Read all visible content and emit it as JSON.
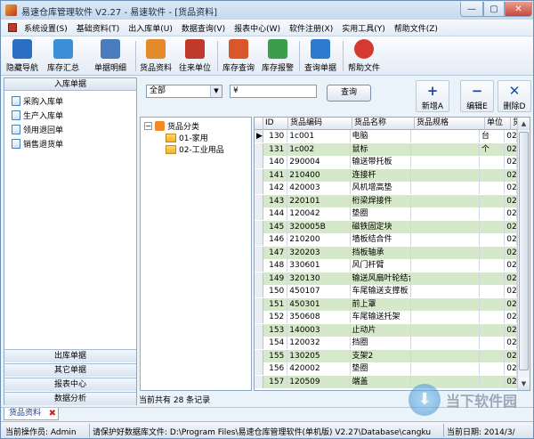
{
  "window": {
    "title": "易速仓库管理软件 V2.27 - 易速软件 - [货品资料]",
    "controls": {
      "minimize": "—",
      "maximize": "▢",
      "close": "✕"
    }
  },
  "menu": [
    "系统设置(S)",
    "基础资料(T)",
    "出入库单(U)",
    "数据查询(V)",
    "报表中心(W)",
    "软件注册(X)",
    "实用工具(Y)",
    "帮助文件(Z)"
  ],
  "toolbar": [
    {
      "label": "隐藏导航",
      "icon": "monitor-icon",
      "color": "#2a6fc4"
    },
    {
      "label": "库存汇总",
      "icon": "chart-icon",
      "color": "#3a8fd8"
    },
    {
      "label": "单据明细",
      "icon": "document-icon",
      "color": "#4a7bbf"
    },
    {
      "label": "货品资料",
      "icon": "box-icon",
      "color": "#e48a2b"
    },
    {
      "label": "往来单位",
      "icon": "people-icon",
      "color": "#c0392b"
    },
    {
      "label": "库存查询",
      "icon": "bar-chart-icon",
      "color": "#d9572a"
    },
    {
      "label": "库存报警",
      "icon": "alarm-icon",
      "color": "#3c9d4a"
    },
    {
      "label": "查询单据",
      "icon": "search-doc-icon",
      "color": "#2c7bd0"
    },
    {
      "label": "帮助文件",
      "icon": "help-icon",
      "color": "#d43a2f"
    }
  ],
  "sidebar": {
    "header": "入库单据",
    "items": [
      "采购入库单",
      "生产入库单",
      "领用退回单",
      "销售退货单"
    ],
    "sections": [
      "出库单据",
      "其它单据",
      "报表中心",
      "数据分析"
    ]
  },
  "filter": {
    "select_value": "全部",
    "search_value": "¥",
    "query_label": "查询"
  },
  "actions": [
    {
      "label": "新增A",
      "icon": "plus-icon",
      "glyph": "+"
    },
    {
      "label": "编辑E",
      "icon": "minus-icon",
      "glyph": "−"
    },
    {
      "label": "删除D",
      "icon": "delete-icon",
      "glyph": "✕"
    }
  ],
  "tree": {
    "root": "货品分类",
    "children": [
      "01-家用",
      "02-工业用品"
    ]
  },
  "grid": {
    "columns": [
      "ID",
      "货品编码",
      "货品名称",
      "货品规格",
      "单位",
      "货"
    ],
    "rows": [
      [
        "130",
        "1c001",
        "电脑",
        "",
        "台",
        "02"
      ],
      [
        "131",
        "1c002",
        "鼠标",
        "",
        "个",
        "02"
      ],
      [
        "140",
        "290004",
        "输送带托板",
        "",
        "",
        "02"
      ],
      [
        "141",
        "210400",
        "连接杆",
        "",
        "",
        "02"
      ],
      [
        "142",
        "420003",
        "风机增高垫",
        "",
        "",
        "02"
      ],
      [
        "143",
        "220101",
        "桁梁焊接件",
        "",
        "",
        "02"
      ],
      [
        "144",
        "120042",
        "垫圈",
        "",
        "",
        "02"
      ],
      [
        "145",
        "320005B",
        "磁铁固定块",
        "",
        "",
        "02"
      ],
      [
        "146",
        "210200",
        "墙板结合件",
        "",
        "",
        "02"
      ],
      [
        "147",
        "320203",
        "挡板轴承",
        "",
        "",
        "02"
      ],
      [
        "148",
        "330601",
        "风门杆臂",
        "",
        "",
        "02"
      ],
      [
        "149",
        "320130",
        "输送风扇叶轮结合",
        "",
        "",
        "02"
      ],
      [
        "150",
        "450107",
        "车尾输送支撑板",
        "",
        "",
        "02"
      ],
      [
        "151",
        "450301",
        "前上罩",
        "",
        "",
        "02"
      ],
      [
        "152",
        "350608",
        "车尾输送托架",
        "",
        "",
        "02"
      ],
      [
        "153",
        "140003",
        "止动片",
        "",
        "",
        "02"
      ],
      [
        "154",
        "120032",
        "挡圈",
        "",
        "",
        "02"
      ],
      [
        "155",
        "130205",
        "支架2",
        "",
        "",
        "02"
      ],
      [
        "156",
        "420002",
        "垫圈",
        "",
        "",
        "02"
      ],
      [
        "157",
        "120509",
        "端盖",
        "",
        "",
        "02"
      ]
    ],
    "row_marker": "▶",
    "count_text": "当前共有 28 条记录"
  },
  "doc_tab": {
    "label": "货品资料"
  },
  "status": {
    "operator": "当前操作员: Admin",
    "db_path": "请保护好数据库文件: D:\\Program Files\\易速仓库管理软件(单机版) V2.27\\Database\\cangku",
    "date": "当前日期: 2014/3/"
  },
  "watermark": {
    "text": "当下软件园"
  }
}
